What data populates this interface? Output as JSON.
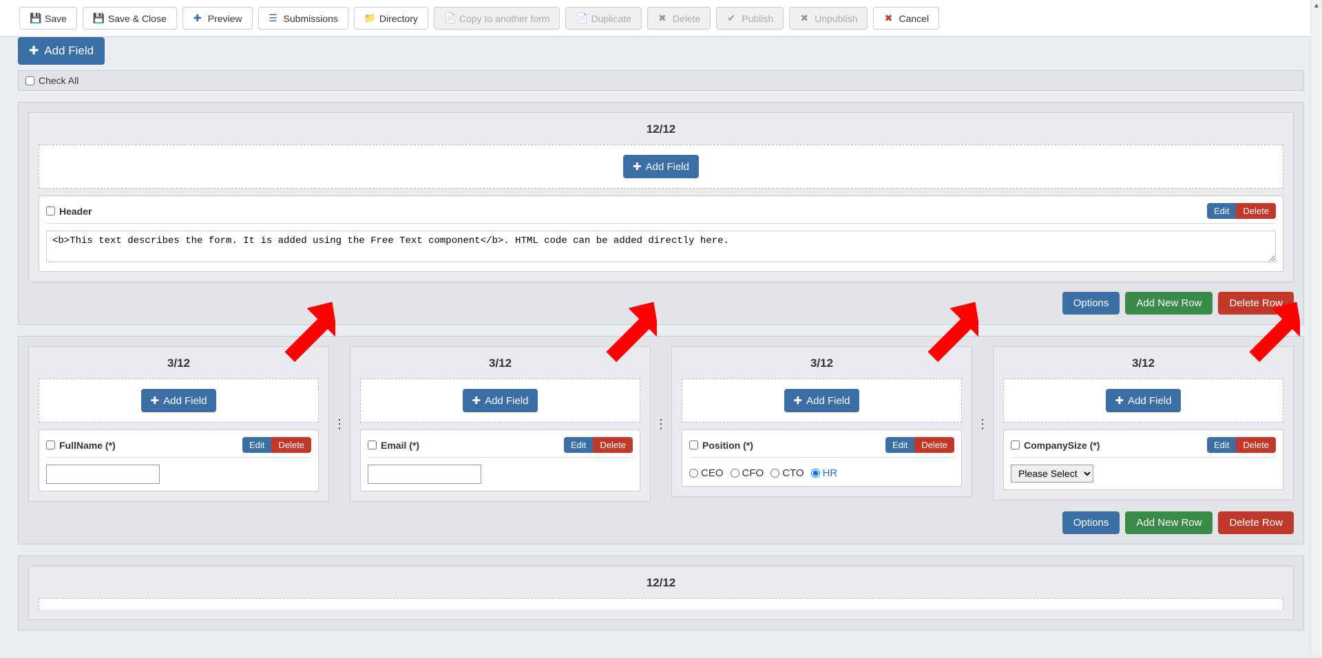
{
  "toolbar": {
    "save": "Save",
    "saveClose": "Save & Close",
    "preview": "Preview",
    "submissions": "Submissions",
    "directory": "Directory",
    "copy": "Copy to another form",
    "duplicate": "Duplicate",
    "delete": "Delete",
    "publish": "Publish",
    "unpublish": "Unpublish",
    "cancel": "Cancel"
  },
  "top": {
    "addField": "Add Field",
    "checkAll": "Check All"
  },
  "row1": {
    "label": "12/12",
    "addField": "Add Field",
    "headerField": {
      "title": "Header",
      "edit": "Edit",
      "del": "Delete",
      "text": "<b>This text describes the form. It is added using the Free Text component</b>. HTML code can be added directly here."
    },
    "options": "Options",
    "addRow": "Add New Row",
    "delRow": "Delete Row"
  },
  "row2": {
    "col1": {
      "label": "3/12",
      "addField": "Add Field",
      "fieldTitle": "FullName (*)",
      "edit": "Edit",
      "del": "Delete"
    },
    "col2": {
      "label": "3/12",
      "addField": "Add Field",
      "fieldTitle": "Email (*)",
      "edit": "Edit",
      "del": "Delete"
    },
    "col3": {
      "label": "3/12",
      "addField": "Add Field",
      "fieldTitle": "Position (*)",
      "edit": "Edit",
      "del": "Delete",
      "options": {
        "ceo": "CEO",
        "cfo": "CFO",
        "cto": "CTO",
        "hr": "HR"
      },
      "selected": "hr"
    },
    "col4": {
      "label": "3/12",
      "addField": "Add Field",
      "fieldTitle": "CompanySize (*)",
      "edit": "Edit",
      "del": "Delete",
      "selectPlaceholder": "Please Select"
    },
    "options": "Options",
    "addRow": "Add New Row",
    "delRow": "Delete Row"
  },
  "row3": {
    "label": "12/12"
  }
}
